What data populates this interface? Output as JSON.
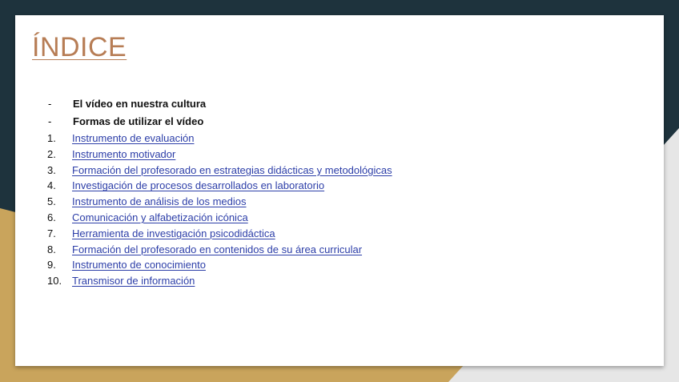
{
  "slide": {
    "title": "ÍNDICE",
    "bullets": [
      {
        "marker": "-",
        "text": "El vídeo en nuestra cultura"
      },
      {
        "marker": "-",
        "text": "Formas de utilizar el vídeo"
      }
    ],
    "numbered": [
      {
        "marker": "1.",
        "text": "Instrumento de evaluación"
      },
      {
        "marker": "2.",
        "text": "Instrumento motivador"
      },
      {
        "marker": "3.",
        "text": "Formación del profesorado en estrategias didácticas y metodológicas"
      },
      {
        "marker": "4.",
        "text": "Investigación de procesos desarrollados en laboratorio"
      },
      {
        "marker": "5.",
        "text": "Instrumento de análisis de los medios"
      },
      {
        "marker": "6.",
        "text": "Comunicación y alfabetización icónica"
      },
      {
        "marker": "7.",
        "text": "Herramienta de investigación psicodidáctica"
      },
      {
        "marker": "8.",
        "text": "Formación del profesorado en contenidos de su área curricular"
      },
      {
        "marker": "9.",
        "text": "Instrumento de conocimiento"
      },
      {
        "marker": "10.",
        "text": "Transmisor de información"
      }
    ]
  },
  "colors": {
    "background_dark": "#1e333d",
    "background_gold": "#c9a45c",
    "background_light": "#e6e6e6",
    "title": "#b77d55",
    "link": "#2c3ea8"
  }
}
